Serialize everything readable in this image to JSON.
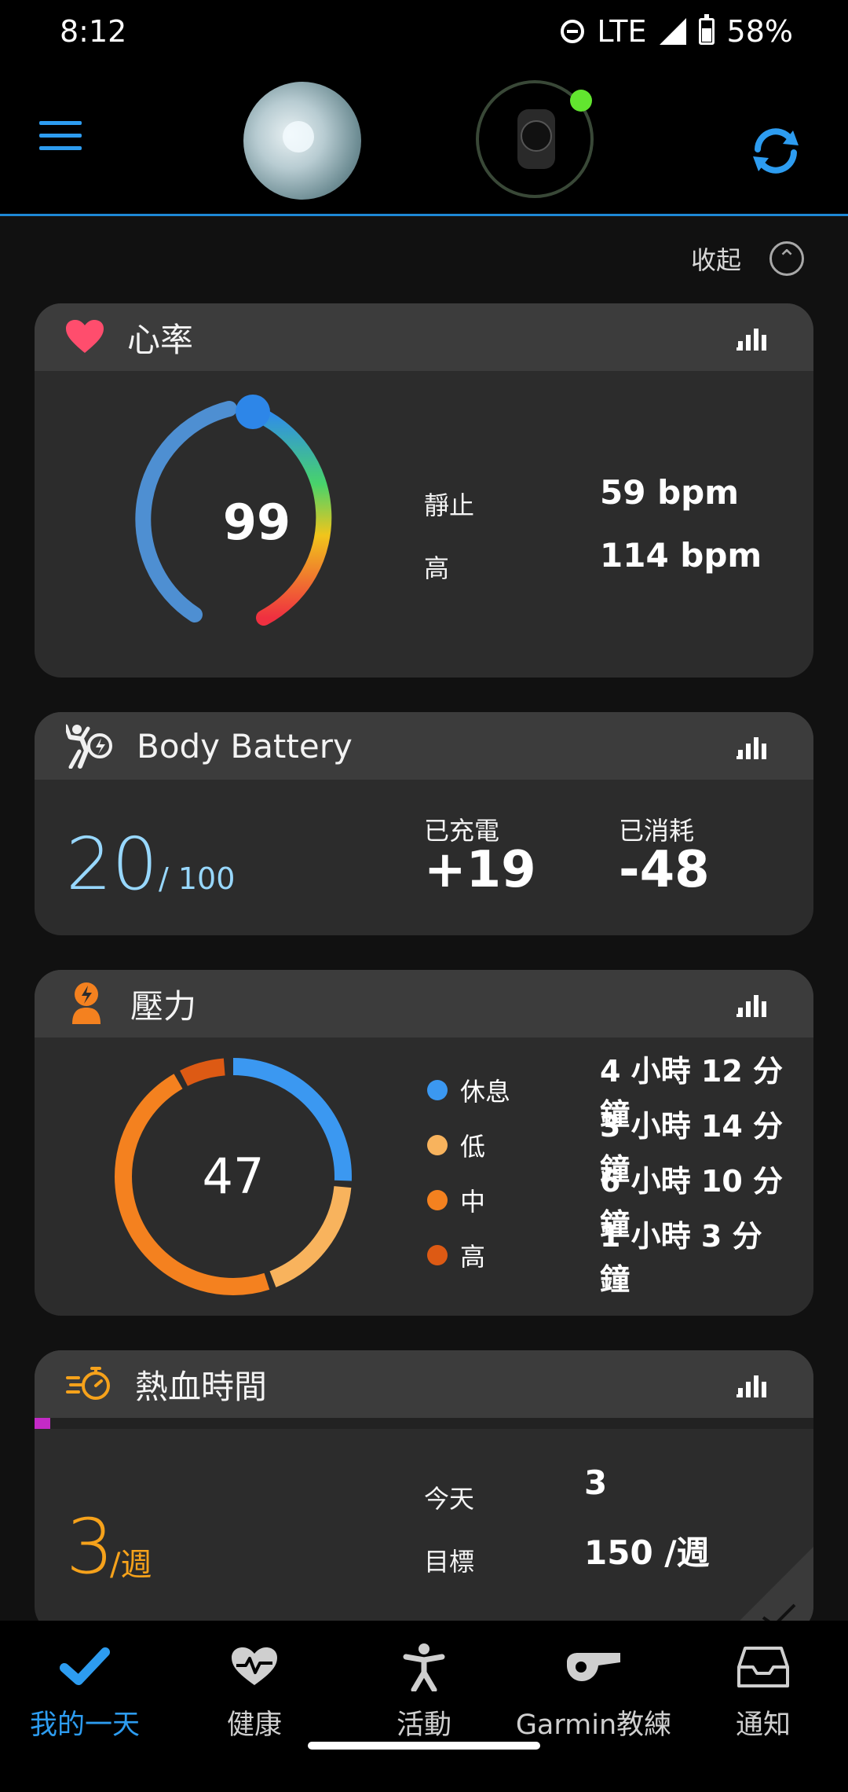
{
  "status_bar": {
    "time": "8:12",
    "network": "LTE",
    "battery": "58%"
  },
  "header": {
    "collapse_label": "收起"
  },
  "heart_rate": {
    "title": "心率",
    "current": "99",
    "rows": [
      {
        "label": "靜止",
        "value": "59 bpm"
      },
      {
        "label": "高",
        "value": "114 bpm"
      }
    ]
  },
  "body_battery": {
    "title": "Body Battery",
    "value": "20",
    "max": "/ 100",
    "charged_label": "已充電",
    "charged_value": "+19",
    "drained_label": "已消耗",
    "drained_value": "-48"
  },
  "stress": {
    "title": "壓力",
    "current": "47",
    "rows": [
      {
        "label": "休息",
        "value": "4 小時 12 分鐘",
        "color": "#3b98f1"
      },
      {
        "label": "低",
        "value": "3 小時 14 分鐘",
        "color": "#f8b35d"
      },
      {
        "label": "中",
        "value": "6 小時 10 分鐘",
        "color": "#f4811f"
      },
      {
        "label": "高",
        "value": "1 小時 3 分鐘",
        "color": "#dd5a14"
      }
    ]
  },
  "intensity": {
    "title": "熱血時間",
    "value": "3",
    "unit": "/週",
    "today_label": "今天",
    "today_value": "3",
    "goal_label": "目標",
    "goal_value": "150 /週"
  },
  "bottom_nav": [
    {
      "label": "我的一天",
      "icon": "check-icon",
      "active": true
    },
    {
      "label": "健康",
      "icon": "heart-pulse-icon",
      "active": false
    },
    {
      "label": "活動",
      "icon": "person-icon",
      "active": false
    },
    {
      "label": "Garmin教練",
      "icon": "whistle-icon",
      "active": false
    },
    {
      "label": "通知",
      "icon": "inbox-icon",
      "active": false
    }
  ],
  "colors": {
    "accent_blue": "#2d9cf0",
    "heart_red": "#ff4d6d",
    "stress_orange": "#f4811f",
    "intensity_orange": "#f6a21b",
    "progress_magenta": "#c42ac7"
  }
}
